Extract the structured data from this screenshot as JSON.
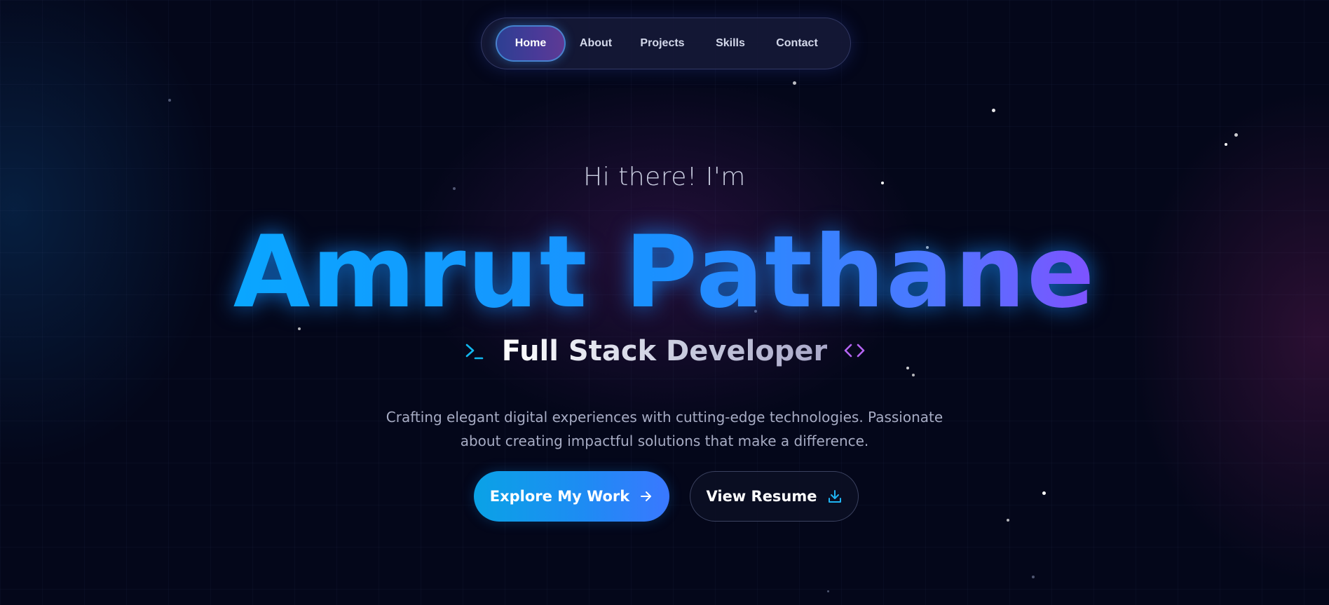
{
  "nav": {
    "items": [
      {
        "label": "Home",
        "active": true
      },
      {
        "label": "About"
      },
      {
        "label": "Projects"
      },
      {
        "label": "Skills"
      },
      {
        "label": "Contact"
      }
    ]
  },
  "hero": {
    "greeting": "Hi there! I'm",
    "name": "Amrut Pathane",
    "role": "Full Stack Developer",
    "description": "Crafting elegant digital experiences with cutting-edge technologies. Passionate about creating impactful solutions that make a difference.",
    "role_icons": [
      "terminal-icon",
      "code-icon"
    ]
  },
  "buttons": {
    "primary": {
      "label": "Explore My Work",
      "icon": "arrow-right-icon"
    },
    "secondary": {
      "label": "View Resume",
      "icon": "download-icon"
    }
  },
  "colors": {
    "background": "#04071a",
    "accent_cyan": "#0aa6ff",
    "accent_violet": "#7f52ff",
    "terminal_icon": "#11b8f0",
    "code_icon": "#b665f5"
  }
}
